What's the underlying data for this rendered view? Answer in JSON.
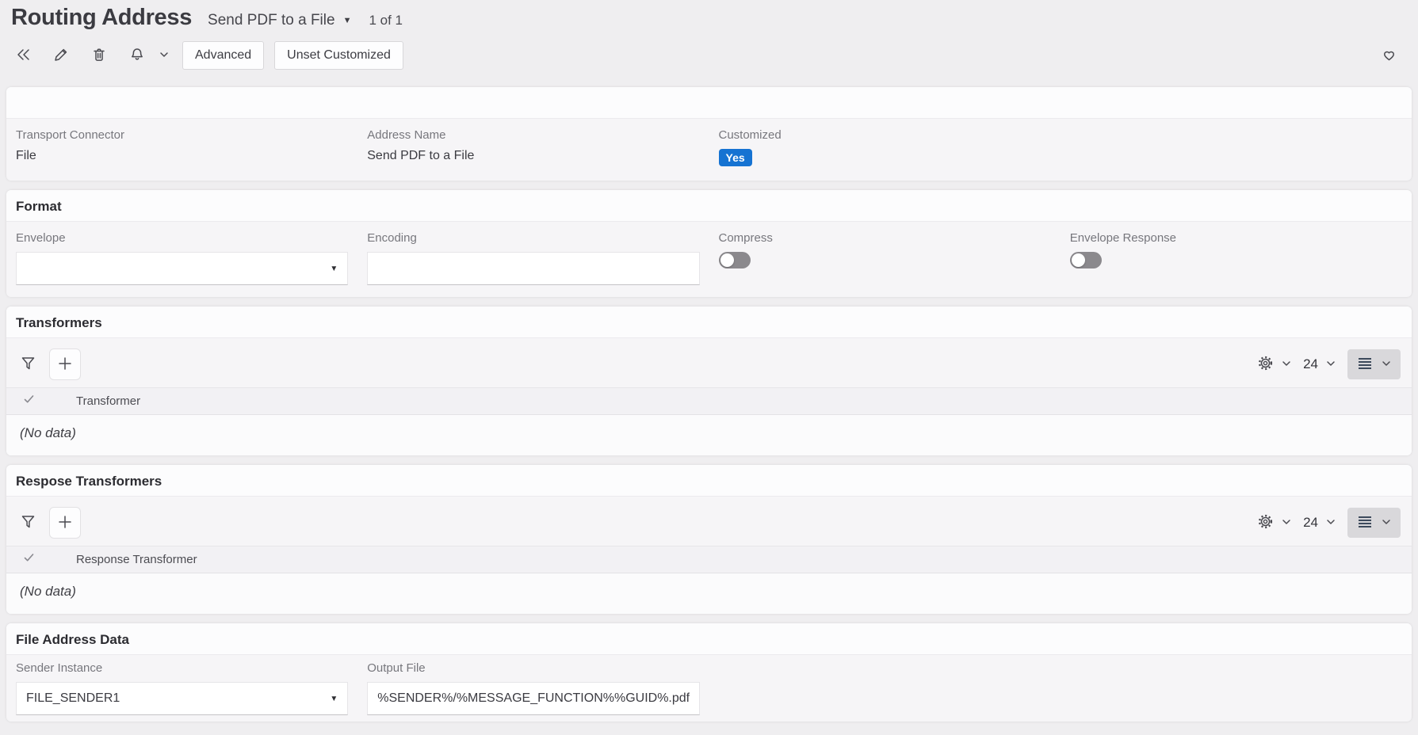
{
  "page": {
    "title": "Routing Address",
    "record_selector": "Send PDF to a File",
    "pagination": "1 of 1"
  },
  "toolbar": {
    "advanced_label": "Advanced",
    "unset_customized_label": "Unset Customized"
  },
  "summary": {
    "fields": [
      {
        "label": "Transport Connector",
        "value": "File"
      },
      {
        "label": "Address Name",
        "value": "Send PDF to a File"
      },
      {
        "label": "Customized",
        "badge": "Yes"
      }
    ]
  },
  "format_section": {
    "title": "Format",
    "envelope_label": "Envelope",
    "envelope_value": "",
    "encoding_label": "Encoding",
    "encoding_value": "",
    "compress_label": "Compress",
    "compress_state": "off",
    "envelope_response_label": "Envelope Response",
    "envelope_response_state": "off"
  },
  "transformers_section": {
    "title": "Transformers",
    "page_size": "24",
    "column": "Transformer",
    "empty_text": "(No data)"
  },
  "response_transformers_section": {
    "title": "Respose Transformers",
    "page_size": "24",
    "column": "Response Transformer",
    "empty_text": "(No data)"
  },
  "file_address_section": {
    "title": "File Address Data",
    "sender_label": "Sender Instance",
    "sender_value": "FILE_SENDER1",
    "output_label": "Output File",
    "output_value": "%SENDER%/%MESSAGE_FUNCTION%%GUID%.pdf"
  },
  "colors": {
    "badge_blue": "#1673d2",
    "toggle_off_gray": "#8b898d",
    "page_background": "#efeef0",
    "card_body": "#f6f5f7",
    "view_icon_dark": "#3d4a5c"
  }
}
